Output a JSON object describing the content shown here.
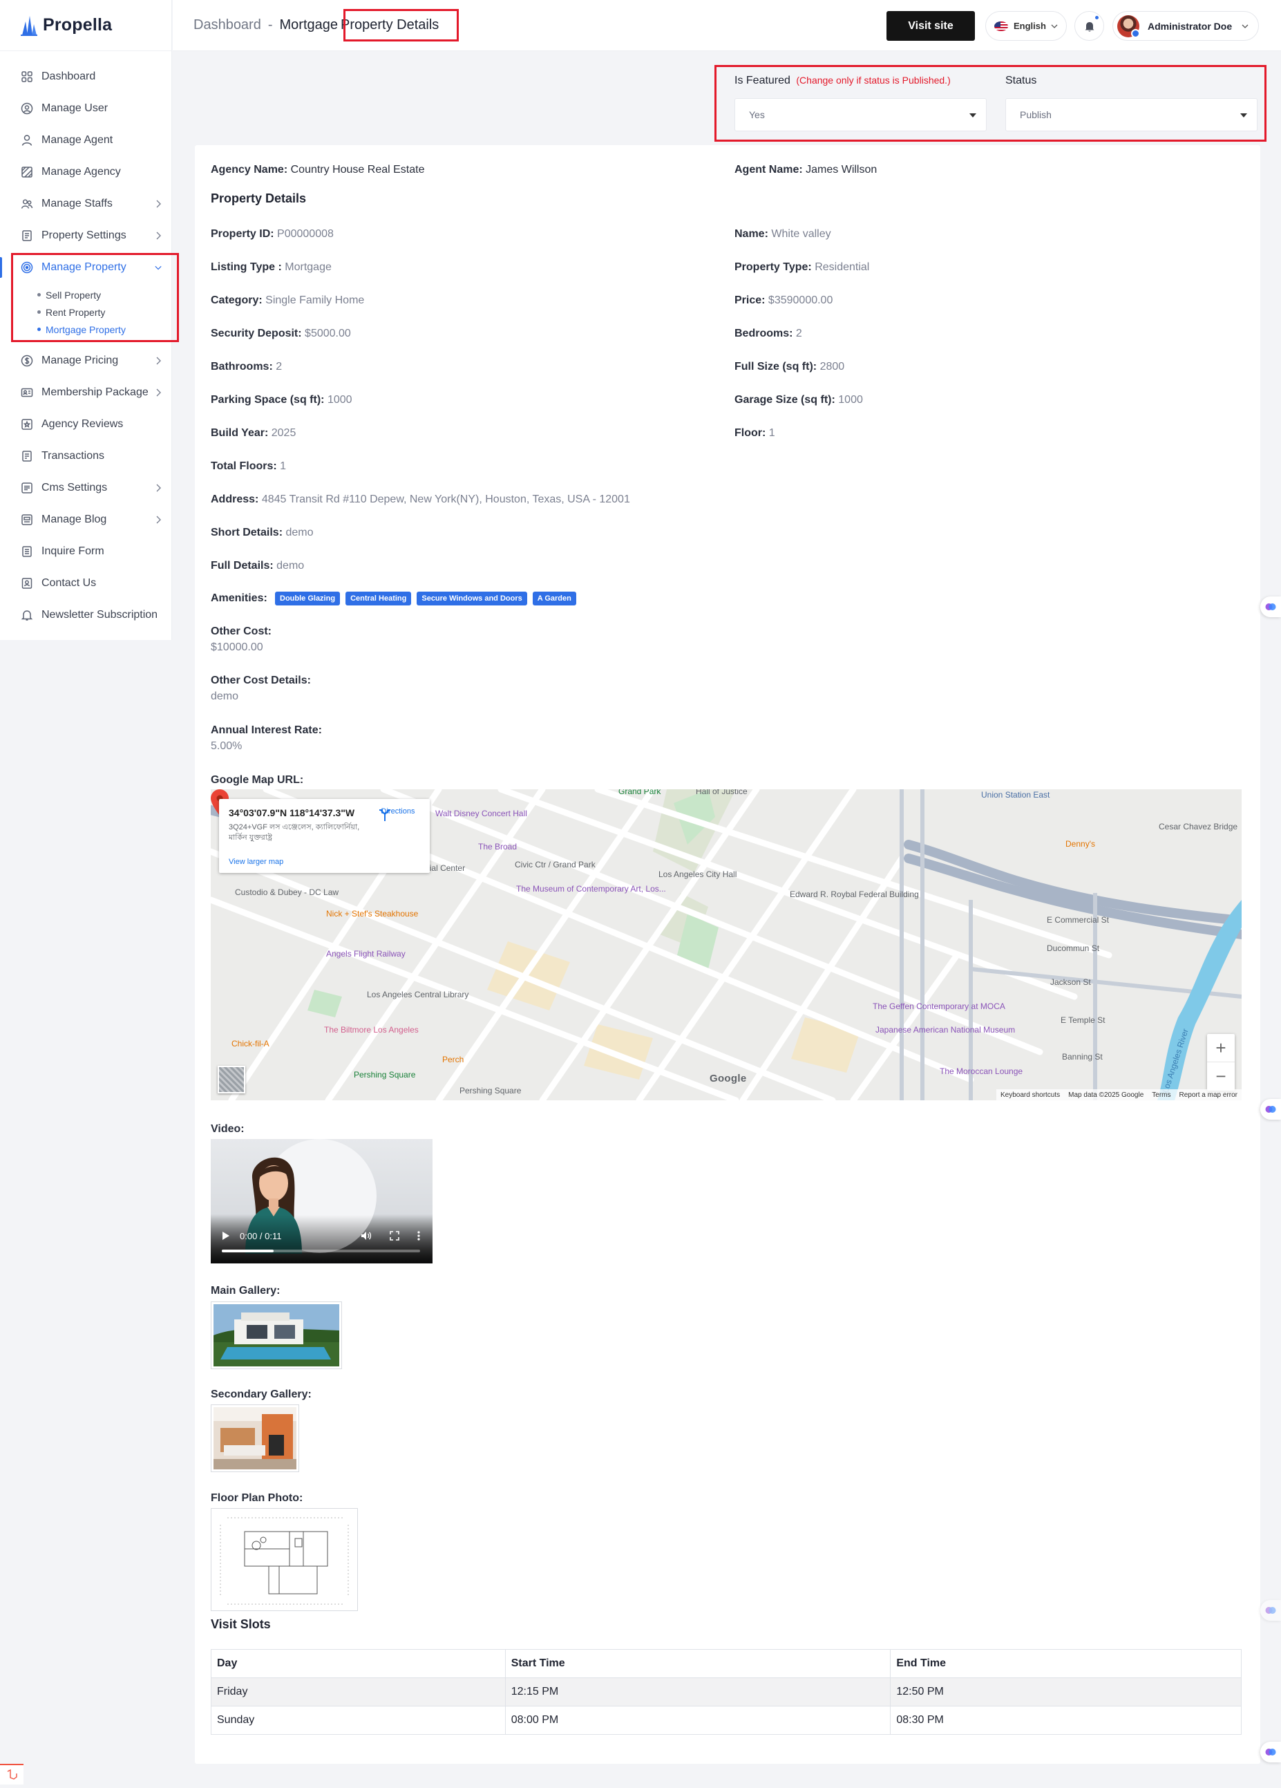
{
  "app": {
    "name": "Propella"
  },
  "sidebar": {
    "items": [
      {
        "label": "Dashboard",
        "icon": "dashboard-grid-icon"
      },
      {
        "label": "Manage User",
        "icon": "user-circle-icon"
      },
      {
        "label": "Manage Agent",
        "icon": "agent-icon"
      },
      {
        "label": "Manage Agency",
        "icon": "agency-icon"
      },
      {
        "label": "Manage Staffs",
        "icon": "staff-icon"
      },
      {
        "label": "Property Settings",
        "icon": "settings-doc-icon"
      },
      {
        "label": "Manage Property",
        "icon": "property-target-icon"
      },
      {
        "label": "Manage Pricing",
        "icon": "pricing-icon"
      },
      {
        "label": "Membership Package",
        "icon": "membership-icon"
      },
      {
        "label": "Agency Reviews",
        "icon": "reviews-icon"
      },
      {
        "label": "Transactions",
        "icon": "transactions-icon"
      },
      {
        "label": "Cms Settings",
        "icon": "cms-icon"
      },
      {
        "label": "Manage Blog",
        "icon": "blog-icon"
      },
      {
        "label": "Inquire Form",
        "icon": "form-icon"
      },
      {
        "label": "Contact Us",
        "icon": "contact-icon"
      },
      {
        "label": "Newsletter Subscription",
        "icon": "bell-icon"
      }
    ],
    "sub_items": [
      "Sell Property",
      "Rent Property",
      "Mortgage Property"
    ]
  },
  "header": {
    "breadcrumb_root": "Dashboard",
    "breadcrumb_sep": "-",
    "breadcrumb_mid": "Mortgage",
    "breadcrumb_current": "Property Details",
    "visit_site": "Visit site",
    "language": "English",
    "user_name": "Administrator Doe"
  },
  "featured": {
    "label": "Is Featured",
    "warning": "(Change only if status is Published.)",
    "value": "Yes"
  },
  "status": {
    "label": "Status",
    "value": "Publish"
  },
  "details": {
    "agency_label": "Agency Name:",
    "agency_value": "Country House Real Estate",
    "agent_label": "Agent Name:",
    "agent_value": "James Willson",
    "section_title": "Property Details",
    "fields": [
      {
        "label": "Property ID:",
        "value": "P00000008"
      },
      {
        "label": "Name:",
        "value": "White valley"
      },
      {
        "label": "Listing Type :",
        "value": "Mortgage"
      },
      {
        "label": "Property Type:",
        "value": "Residential"
      },
      {
        "label": "Category:",
        "value": "Single Family Home"
      },
      {
        "label": "Price:",
        "value": "$3590000.00"
      },
      {
        "label": "Security Deposit:",
        "value": "$5000.00"
      },
      {
        "label": "Bedrooms:",
        "value": "2"
      },
      {
        "label": "Bathrooms:",
        "value": "2"
      },
      {
        "label": "Full Size (sq ft):",
        "value": "2800"
      },
      {
        "label": "Parking Space (sq ft):",
        "value": "1000"
      },
      {
        "label": "Garage Size (sq ft):",
        "value": "1000"
      },
      {
        "label": "Build Year:",
        "value": "2025"
      },
      {
        "label": "Floor:",
        "value": "1"
      },
      {
        "label": "Total Floors:",
        "value": "1"
      }
    ],
    "address_label": "Address:",
    "address_value": "4845 Transit Rd #110 Depew, New York(NY), Houston, Texas, USA - 12001",
    "short_label": "Short Details:",
    "short_value": "demo",
    "full_label": "Full Details:",
    "full_value": "demo",
    "amenities_label": "Amenities:",
    "amenities": [
      "Double Glazing",
      "Central Heating",
      "Secure Windows and Doors",
      "A Garden"
    ],
    "other_cost_label": "Other Cost:",
    "other_cost_value": "$10000.00",
    "other_cost_details_label": "Other Cost Details:",
    "other_cost_details_value": "demo",
    "interest_label": "Annual Interest Rate:",
    "interest_value": "5.00%",
    "map_label": "Google Map URL:",
    "video_label": "Video:",
    "main_gallery_label": "Main Gallery:",
    "secondary_gallery_label": "Secondary Gallery:",
    "floor_plan_label": "Floor Plan Photo:"
  },
  "map": {
    "coords": "34°03'07.9\"N 118°14'37.3\"W",
    "address": "3Q24+VGF লস এঞ্জেলেস, ক্যালিফোর্নিয়া, মার্কিন যুক্তরাষ্ট্র",
    "directions": "Directions",
    "larger": "View larger map",
    "labels": [
      "Walt Disney Concert Hall",
      "The Broad",
      "Civic Ctr / Grand Park",
      "Los Angeles City Hall",
      "Hall of Justice",
      "Union Station East",
      "Cesar Chavez Bridge",
      "Denny's",
      "Bank of America Financial Center",
      "The Museum of Contemporary Art, Los...",
      "Edward R. Roybal Federal Building",
      "Custodio & Dubey - DC Law",
      "Nick + Stef's Steakhouse",
      "Angels Flight Railway",
      "E Commercial St",
      "Ducommun St",
      "Jackson St",
      "E Temple St",
      "Banning St",
      "Los Angeles Central Library",
      "The Geffen Contemporary at MOCA",
      "The Biltmore Los Angeles",
      "Japanese American National Museum",
      "Chick-fil-A",
      "Perch",
      "Pershing Square",
      "The Moroccan Lounge",
      "Los Angeles River",
      "Grand Park"
    ],
    "footer": [
      "Keyboard shortcuts",
      "Map data ©2025 Google",
      "Terms",
      "Report a map error"
    ],
    "google": "Google"
  },
  "video": {
    "time": "0:00 / 0:11",
    "progress": 0.26
  },
  "visit_slots": {
    "title": "Visit Slots",
    "headers": [
      "Day",
      "Start Time",
      "End Time"
    ],
    "rows": [
      [
        "Friday",
        "12:15 PM",
        "12:50 PM"
      ],
      [
        "Sunday",
        "08:00 PM",
        "08:30 PM"
      ]
    ]
  },
  "colors": {
    "accent": "#2f6fe6",
    "highlight": "#e3192a",
    "dark_button": "#141414"
  }
}
